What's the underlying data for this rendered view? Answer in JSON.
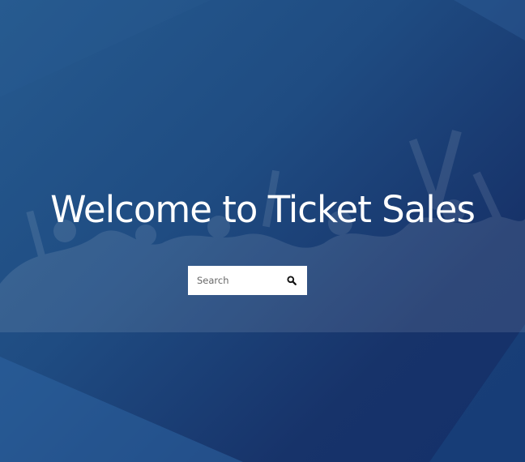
{
  "hero": {
    "title": "Welcome to Ticket Sales",
    "background_color": "#1f4c82",
    "background_image": "concert-crowd-silhouette"
  },
  "search": {
    "placeholder": "Search",
    "value": "",
    "button_icon": "search-icon"
  },
  "colors": {
    "title_text": "#ffffff",
    "search_background": "#ffffff",
    "search_icon": "#111111"
  }
}
